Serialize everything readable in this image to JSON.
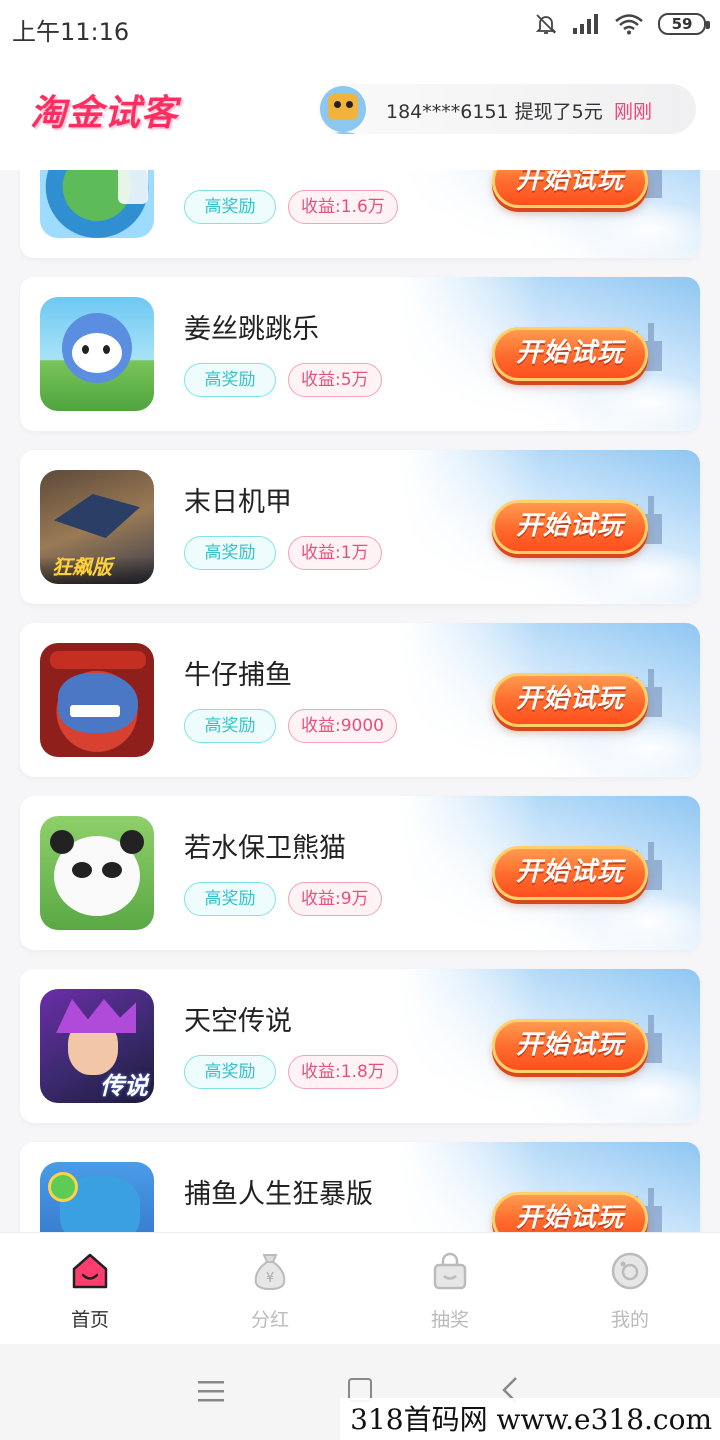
{
  "status_bar": {
    "time": "上午11:16",
    "battery": "59",
    "icons": [
      "bell-off-icon",
      "signal-icon",
      "wifi-icon",
      "battery-icon"
    ]
  },
  "header": {
    "logo": "淘金试客",
    "ticker": {
      "message": "184****6151 提现了5元",
      "time": "刚刚"
    }
  },
  "colors": {
    "brand": "#ff2e62",
    "play_button": "#ff6a2c",
    "tag_reward": "#33c3cc",
    "tag_income": "#e8507a"
  },
  "games": [
    {
      "title": "",
      "tag_reward": "高奖励",
      "tag_income": "收益:1.6万",
      "button": "开始试玩"
    },
    {
      "title": "姜丝跳跳乐",
      "tag_reward": "高奖励",
      "tag_income": "收益:5万",
      "button": "开始试玩"
    },
    {
      "title": "末日机甲",
      "tag_reward": "高奖励",
      "tag_income": "收益:1万",
      "button": "开始试玩",
      "thumb_text": "狂飙版"
    },
    {
      "title": "牛仔捕鱼",
      "tag_reward": "高奖励",
      "tag_income": "收益:9000",
      "button": "开始试玩"
    },
    {
      "title": "若水保卫熊猫",
      "tag_reward": "高奖励",
      "tag_income": "收益:9万",
      "button": "开始试玩"
    },
    {
      "title": "天空传说",
      "tag_reward": "高奖励",
      "tag_income": "收益:1.8万",
      "button": "开始试玩",
      "thumb_text": "传说"
    },
    {
      "title": "捕鱼人生狂暴版",
      "tag_reward": "",
      "tag_income": "",
      "button": "开始试玩"
    }
  ],
  "tabbar": {
    "tabs": [
      {
        "label": "首页",
        "icon": "home-icon",
        "active": true
      },
      {
        "label": "分红",
        "icon": "money-bag-icon",
        "active": false
      },
      {
        "label": "抽奖",
        "icon": "shopping-bag-icon",
        "active": false
      },
      {
        "label": "我的",
        "icon": "profile-icon",
        "active": false
      }
    ]
  },
  "watermark": "318首码网 www.e318.com"
}
